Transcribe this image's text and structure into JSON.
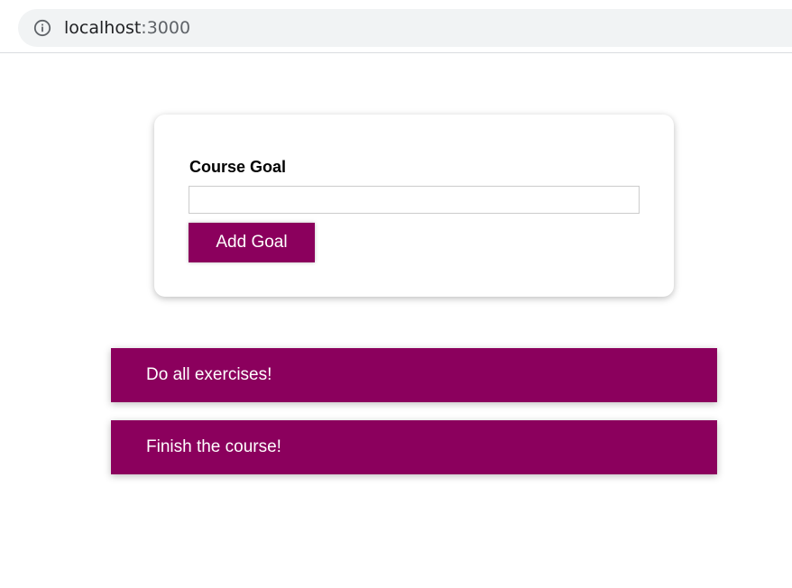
{
  "browser": {
    "url_host": "localhost",
    "url_port": ":3000",
    "info_icon": "info-circle-icon"
  },
  "form": {
    "label": "Course Goal",
    "input_value": "",
    "button_label": "Add Goal"
  },
  "goals": [
    {
      "text": "Do all exercises!"
    },
    {
      "text": "Finish the course!"
    }
  ],
  "colors": {
    "accent": "#8b005d",
    "address_bar_bg": "#f1f3f4"
  }
}
